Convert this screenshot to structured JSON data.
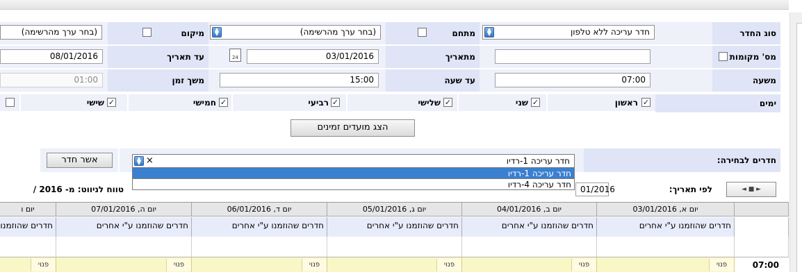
{
  "form": {
    "room_type": {
      "label": "סוג החדר",
      "value": "חדר עריכה ללא טלפון"
    },
    "complex": {
      "label": "מתחם",
      "value": "(בחר ערך מהרשימה)"
    },
    "location": {
      "label": "מיקום",
      "value": "(בחר ערך מהרשימה)"
    },
    "seats": {
      "label": "מס' מקומות",
      "value": ""
    },
    "from_date": {
      "label": "מתאריך",
      "value": "03/01/2016"
    },
    "to_date": {
      "label": "עד תאריך",
      "value": "08/01/2016"
    },
    "from_hour": {
      "label": "משעה",
      "value": "07:00"
    },
    "to_hour": {
      "label": "עד שעה",
      "value": "15:00"
    },
    "duration": {
      "label": "משך זמן",
      "value": "01:00"
    },
    "calendar_day": "24",
    "days": {
      "label": "ימים",
      "items": [
        {
          "label": "ראשון",
          "checked": true
        },
        {
          "label": "שני",
          "checked": true
        },
        {
          "label": "שלישי",
          "checked": true
        },
        {
          "label": "רביעי",
          "checked": true
        },
        {
          "label": "חמישי",
          "checked": true
        },
        {
          "label": "שישי",
          "checked": true
        }
      ]
    }
  },
  "show_slots_button": "הצג מועדים זמינים",
  "rooms": {
    "label": "חדרים לבחירה:",
    "input_value": "חדר עריכה 1-רדיו",
    "clear_symbol": "×",
    "options": [
      {
        "label": "חדר עריכה 1-רדיו",
        "selected": true
      },
      {
        "label": "חדר עריכה 4-רדיו",
        "selected": false
      }
    ],
    "confirm_button": "אשר חדר"
  },
  "nav": {
    "by_date_label": "לפי תאריך:",
    "by_date_value": "01/2016",
    "range_label": "טווח לניווט: מ- 2016 /",
    "pager_symbol": "◄ ■ ►"
  },
  "grid": {
    "columns": [
      {
        "header": "יום א, 03/01/2016",
        "note": "חדרים שהוזמנו ע\"י אחרים",
        "slot": "פנוי"
      },
      {
        "header": "יום ב, 04/01/2016",
        "note": "חדרים שהוזמנו ע\"י אחרים",
        "slot": "פנוי"
      },
      {
        "header": "יום ג, 05/01/2016",
        "note": "חדרים שהוזמנו ע\"י אחרים",
        "slot": "פנוי"
      },
      {
        "header": "יום ד, 06/01/2016",
        "note": "חדרים שהוזמנו ע\"י אחרים",
        "slot": "פנוי"
      },
      {
        "header": "יום ה, 07/01/2016",
        "note": "חדרים שהוזמנו ע\"י אחרים",
        "slot": "פנוי"
      },
      {
        "header": "יום ו",
        "note": "חדרים שהוזמנו",
        "slot": "פנוי"
      }
    ],
    "row_time": "07:00"
  },
  "colors": {
    "label_bg": "#dfe4f6",
    "cell_bg": "#eef0fa",
    "dropdown_selected": "#3b7fd1",
    "slot_bg": "#faf7c6"
  }
}
